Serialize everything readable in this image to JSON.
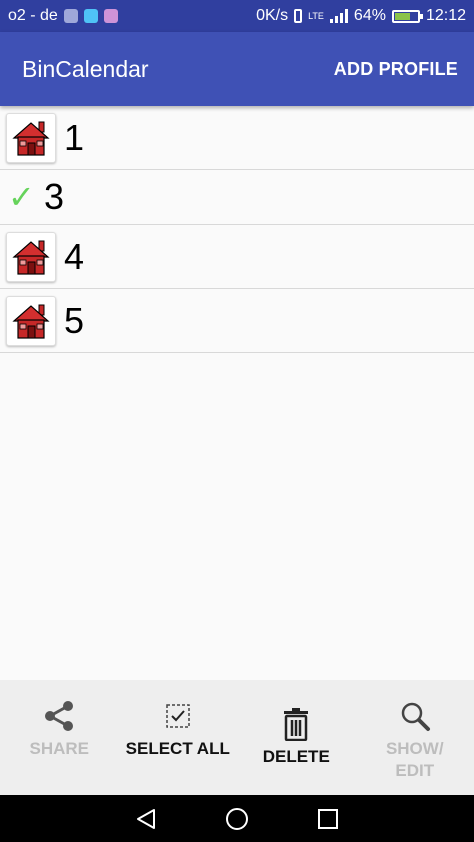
{
  "status_bar": {
    "carrier": "o2 - de",
    "speed": "0K/s",
    "network": "LTE",
    "battery": "64%",
    "time": "12:12"
  },
  "app_bar": {
    "title": "BinCalendar",
    "action": "ADD PROFILE"
  },
  "profiles": [
    {
      "label": "1",
      "icon": "house-icon",
      "selected": false
    },
    {
      "label": "3",
      "icon": "check-icon",
      "selected": true
    },
    {
      "label": "4",
      "icon": "house-icon",
      "selected": false
    },
    {
      "label": "5",
      "icon": "house-icon",
      "selected": false
    }
  ],
  "bottom_bar": {
    "share": "SHARE",
    "select_all": "SELECT ALL",
    "delete": "DELETE",
    "show_edit_1": "SHOW/",
    "show_edit_2": "EDIT"
  },
  "colors": {
    "status_bar": "#303f9f",
    "app_bar": "#3f51b5",
    "check": "#66d35b",
    "house": "#cc1111"
  }
}
